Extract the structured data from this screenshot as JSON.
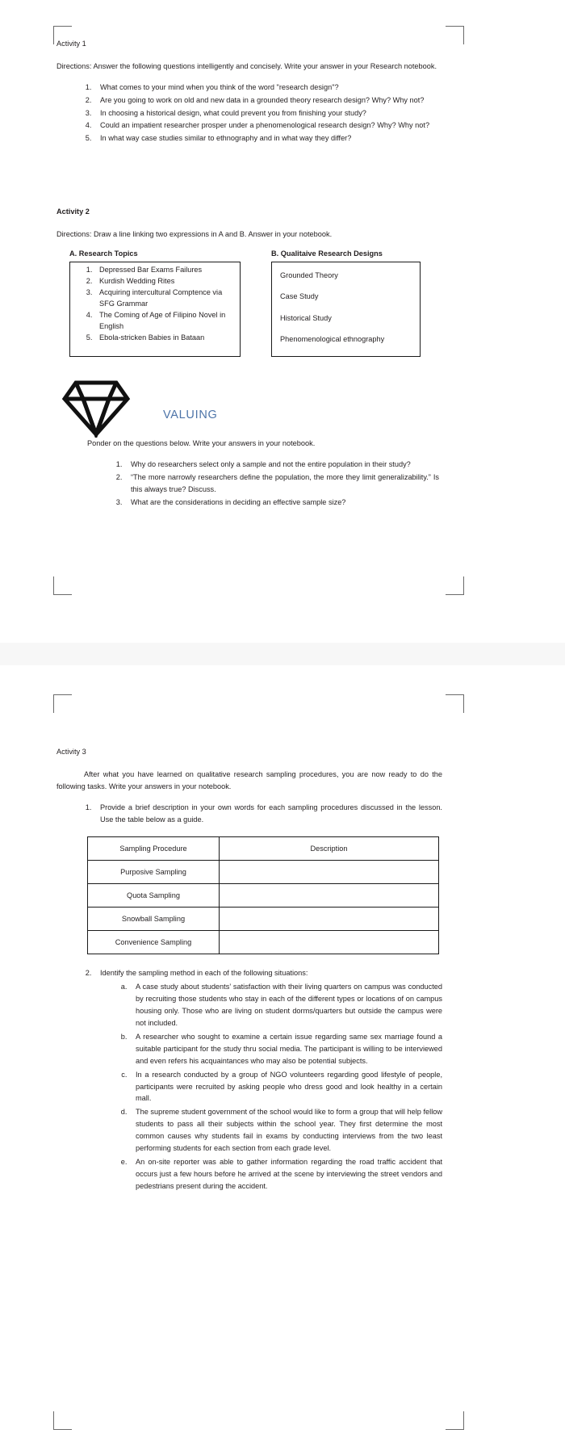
{
  "document": {
    "activity1": {
      "label": "Activity 1",
      "directions": "Directions: Answer the following questions intelligently and concisely. Write your answer in your Research notebook.",
      "questions": [
        "What comes to your mind when you think of the word \"research design\"?",
        "Are you going to work on old and new data in a grounded theory research design? Why? Why not?",
        "In choosing a  historical design, what could prevent you from finishing your study?",
        "Could an impatient researcher prosper under a phenomenological research design? Why? Why not?",
        "In what way case studies similar to ethnography and in what way they differ?"
      ]
    },
    "activity2": {
      "label": "Activity 2",
      "directions": "Directions: Draw a line linking two expressions in A and B. Answer in your notebook.",
      "column_a": {
        "heading": "A. Research Topics",
        "items": [
          "Depressed Bar Exams Failures",
          "Kurdish Wedding Rites",
          "Acquiring intercultural Comptence via SFG Grammar",
          "The Coming of Age of Filipino Novel in English",
          "Ebola-stricken Babies in Bataan"
        ]
      },
      "column_b": {
        "heading": "B. Qualitaive Research Designs",
        "items": [
          "Grounded Theory",
          "Case Study",
          "Historical Study",
          "Phenomenological ethnography"
        ]
      }
    },
    "valuing": {
      "icon": "diamond-icon",
      "title": "VALUING",
      "title_color": "#4d74a8",
      "intro": "Ponder on the questions below. Write your answers in your notebook.",
      "questions": [
        "Why do researchers select only a sample and not the entire population in their study?",
        "“The more narrowly researchers define the population, the more they limit generalizability.” Is this always true? Discuss.",
        "What are the considerations in deciding an effective sample size?"
      ]
    },
    "activity3": {
      "label": "Activity 3",
      "intro": "After what you have learned on qualitative research sampling procedures, you are now ready to do the following tasks. Write your answers in your notebook.",
      "task1": "Provide a brief description in your own words for each sampling procedures discussed in the lesson. Use the table below as a guide.",
      "table": {
        "headers": [
          "Sampling Procedure",
          "Description"
        ],
        "rows": [
          [
            "Purposive Sampling",
            ""
          ],
          [
            "Quota Sampling",
            ""
          ],
          [
            "Snowball Sampling",
            ""
          ],
          [
            "Convenience Sampling",
            ""
          ]
        ]
      },
      "task2": "Identify the sampling method in each of the following situations:",
      "situations": [
        "A case study about students’ satisfaction with their living quarters on campus was conducted by recruiting those students who stay in each of the different types or locations of on campus housing only. Those who are living on student dorms/quarters but outside the campus were not included.",
        "A researcher who sought to examine a certain issue regarding same sex marriage found a suitable participant for the study thru social media. The participant is willing to be interviewed and even refers his acquaintances who may also be potential subjects.",
        "In a research conducted by a group of NGO volunteers regarding good lifestyle of people, participants were recruited by asking people who dress good and look healthy in a certain mall.",
        "The supreme student government of the school would like to form a group that will help fellow students to pass all their subjects within the school year. They first determine the most common causes why students fail in exams by conducting interviews from the two least performing students for each section from each grade level.",
        "An on-site reporter was able to gather information regarding the road traffic accident that occurs just a few hours before he arrived at the scene by interviewing the street vendors and pedestrians present during the accident."
      ]
    }
  }
}
